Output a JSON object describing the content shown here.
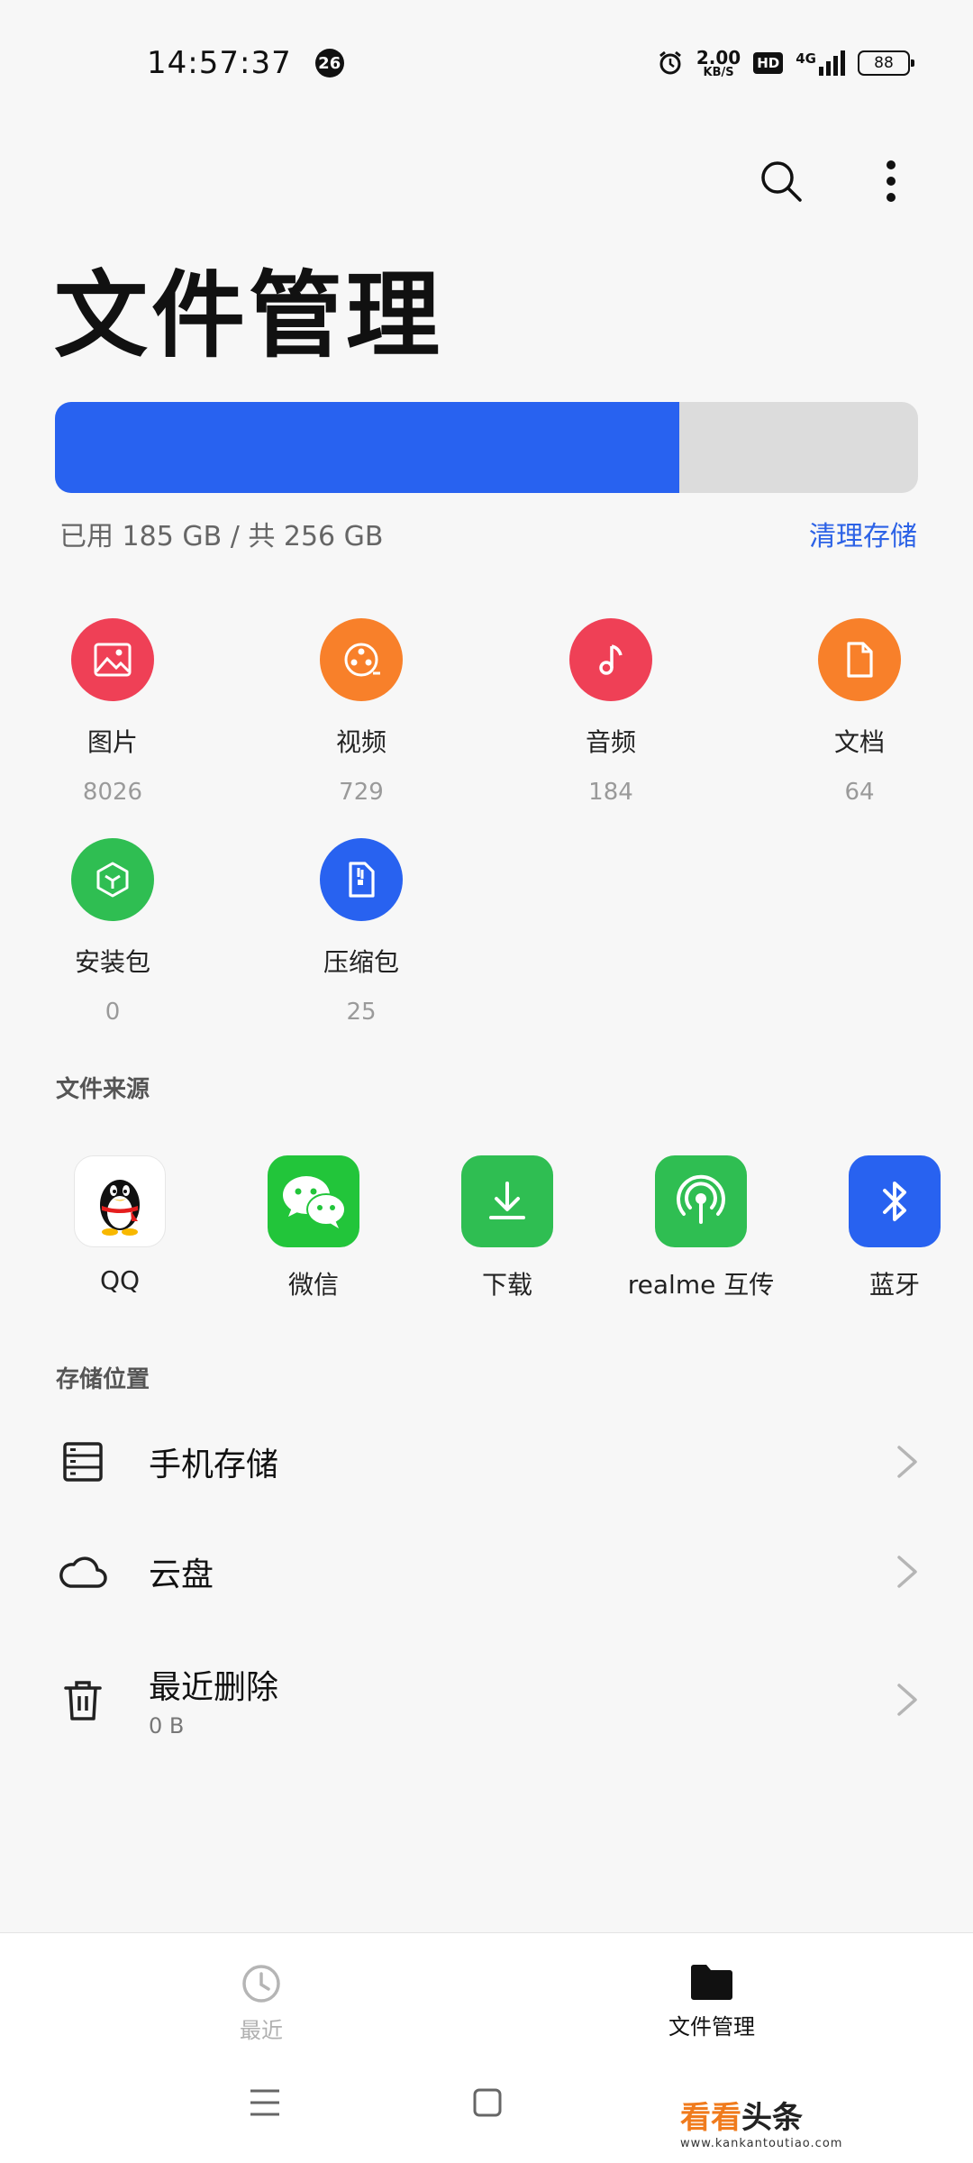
{
  "status_bar": {
    "time": "14:57:37",
    "notification_count": "26",
    "speed_value": "2.00",
    "speed_unit": "KB/S",
    "hd": "HD",
    "network": "4G",
    "battery": "88"
  },
  "header": {
    "title": "文件管理"
  },
  "storage": {
    "used_fraction": 0.723,
    "summary": "已用 185 GB / 共 256 GB",
    "clean_label": "清理存储",
    "used_color": "#2862f0"
  },
  "categories": [
    {
      "label": "图片",
      "count": "8026",
      "color": "#ef4056",
      "icon": "image-icon"
    },
    {
      "label": "视频",
      "count": "729",
      "color": "#f8802a",
      "icon": "video-reel-icon"
    },
    {
      "label": "音频",
      "count": "184",
      "color": "#ef4056",
      "icon": "music-note-icon"
    },
    {
      "label": "文档",
      "count": "64",
      "color": "#f8802a",
      "icon": "document-icon"
    },
    {
      "label": "安装包",
      "count": "0",
      "color": "#2fbe52",
      "icon": "package-icon"
    },
    {
      "label": "压缩包",
      "count": "25",
      "color": "#2862f0",
      "icon": "zip-icon"
    }
  ],
  "sources": {
    "title": "文件来源",
    "items": [
      {
        "label": "QQ",
        "icon": "qq-penguin-icon"
      },
      {
        "label": "微信",
        "icon": "wechat-icon"
      },
      {
        "label": "下载",
        "icon": "download-icon"
      },
      {
        "label": "realme 互传",
        "icon": "realme-share-icon"
      },
      {
        "label": "蓝牙",
        "icon": "bluetooth-icon"
      }
    ]
  },
  "locations": {
    "title": "存储位置",
    "items": [
      {
        "name": "手机存储",
        "sub": "",
        "icon": "phone-storage-icon"
      },
      {
        "name": "云盘",
        "sub": "",
        "icon": "cloud-icon"
      },
      {
        "name": "最近删除",
        "sub": "0 B",
        "icon": "trash-icon"
      }
    ]
  },
  "bottom_nav": {
    "recent": "最近",
    "files": "文件管理"
  },
  "watermark": {
    "main_a": "看看",
    "main_b": "头条",
    "url": "www.kankantoutiao.com"
  }
}
